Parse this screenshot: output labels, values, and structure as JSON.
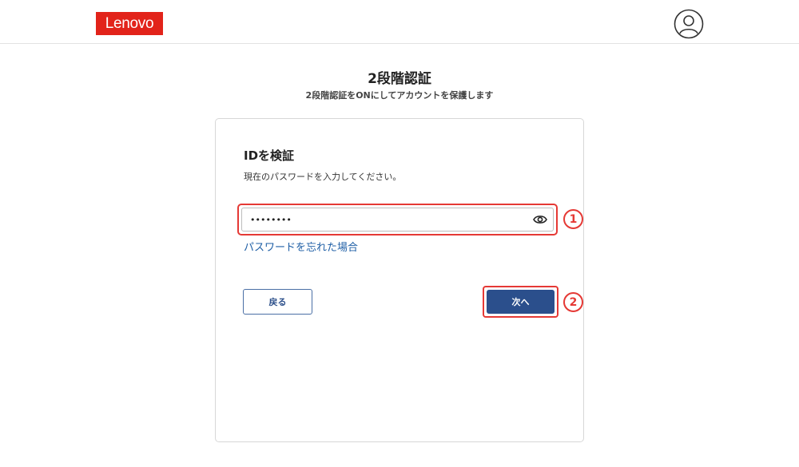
{
  "header": {
    "logo_text": "Lenovo",
    "logo_color": "#e2231a",
    "avatar_icon": "user-avatar-icon"
  },
  "page": {
    "title": "2段階認証",
    "subtitle": "2段階認証をONにしてアカウントを保護します"
  },
  "card": {
    "title": "IDを検証",
    "description": "現在のパスワードを入力してください。",
    "password_value": "••••••••",
    "eye_icon": "eye-icon",
    "forgot_link": "パスワードを忘れた場合",
    "back_label": "戻る",
    "next_label": "次へ"
  },
  "annotations": {
    "marker_1": "1",
    "marker_2": "2",
    "highlight_color": "#e53935"
  },
  "colors": {
    "primary_button": "#2b4f8c",
    "link": "#1f5fa6"
  }
}
